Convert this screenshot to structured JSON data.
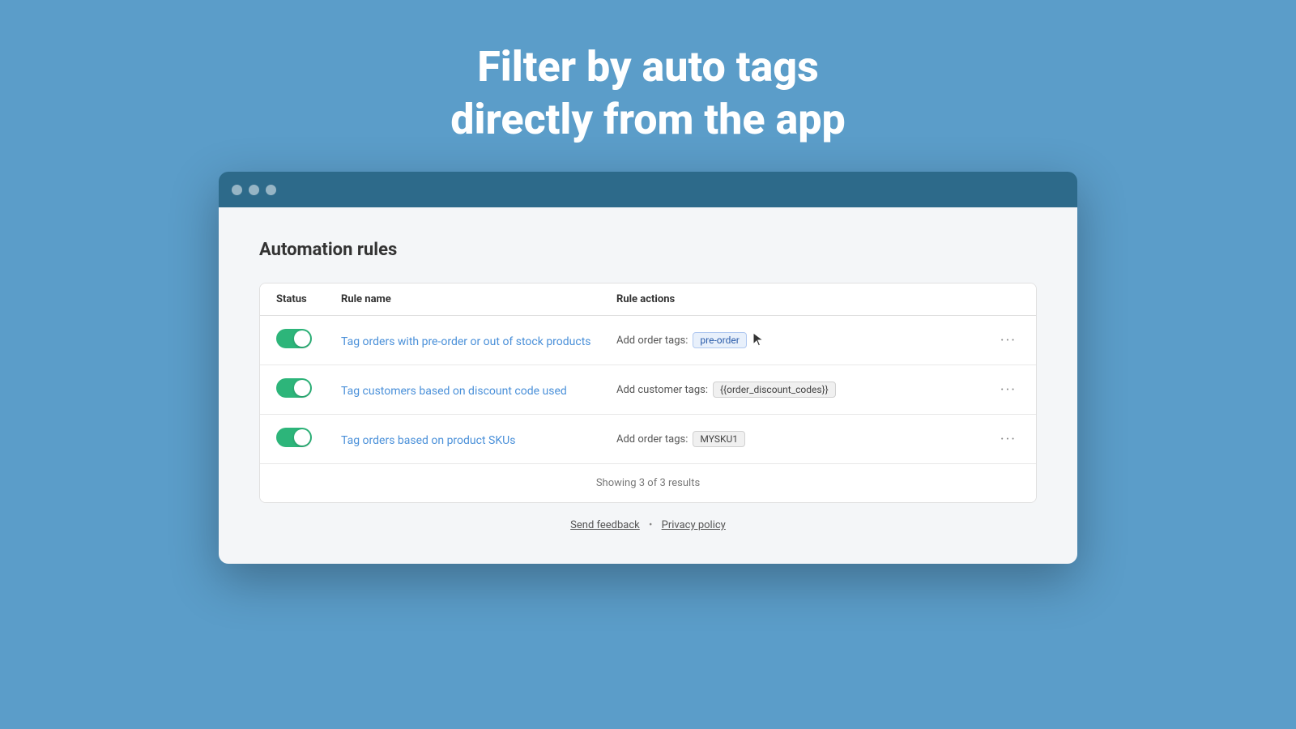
{
  "hero": {
    "line1": "Filter by auto tags",
    "line2": "directly from the app"
  },
  "browser": {
    "page_title": "Automation rules",
    "table": {
      "headers": [
        "Status",
        "Rule name",
        "Rule actions",
        ""
      ],
      "rows": [
        {
          "enabled": true,
          "rule_name": "Tag orders with pre-order or out of stock products",
          "action_label": "Add order tags:",
          "tag": "pre-order",
          "tag_highlighted": true
        },
        {
          "enabled": true,
          "rule_name": "Tag customers based on discount code used",
          "action_label": "Add customer tags:",
          "tag": "{{order_discount_codes}}",
          "tag_highlighted": false
        },
        {
          "enabled": true,
          "rule_name": "Tag orders based on product SKUs",
          "action_label": "Add order tags:",
          "tag": "MYSKU1",
          "tag_highlighted": false
        }
      ],
      "showing_label": "Showing 3 of 3 results"
    }
  },
  "footer": {
    "send_feedback": "Send feedback",
    "separator": "•",
    "privacy_policy": "Privacy policy"
  }
}
